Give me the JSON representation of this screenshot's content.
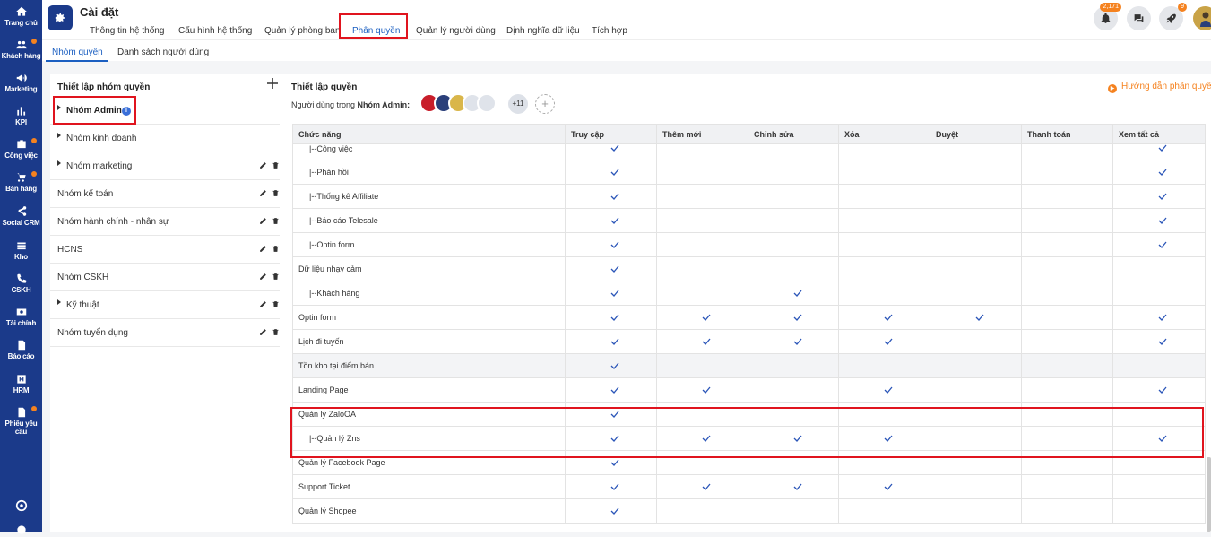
{
  "sidebar": {
    "items": [
      {
        "label": "Trang chủ",
        "icon": "home-icon",
        "dot": false
      },
      {
        "label": "Khách hàng",
        "icon": "customers-icon",
        "dot": true
      },
      {
        "label": "Marketing",
        "icon": "megaphone-icon",
        "dot": false
      },
      {
        "label": "KPI",
        "icon": "chart-icon",
        "dot": false
      },
      {
        "label": "Công việc",
        "icon": "briefcase-icon",
        "dot": true
      },
      {
        "label": "Bán hàng",
        "icon": "cart-icon",
        "dot": true
      },
      {
        "label": "Social CRM",
        "icon": "share-icon",
        "dot": false
      },
      {
        "label": "Kho",
        "icon": "warehouse-icon",
        "dot": false
      },
      {
        "label": "CSKH",
        "icon": "phone-icon",
        "dot": false
      },
      {
        "label": "Tài chính",
        "icon": "money-icon",
        "dot": false
      },
      {
        "label": "Báo cáo",
        "icon": "report-icon",
        "dot": false
      },
      {
        "label": "HRM",
        "icon": "hrm-icon",
        "dot": false
      },
      {
        "label": "Phiếu yêu cầu",
        "icon": "ticket-icon",
        "dot": true
      }
    ]
  },
  "header": {
    "title": "Cài đặt",
    "tabs": [
      "Thông tin hệ thống",
      "Cấu hình hệ thống",
      "Quản lý phòng ban",
      "Phân quyền",
      "Quản lý người dùng",
      "Định nghĩa dữ liệu",
      "Tích hợp"
    ],
    "active_tab": "Phân quyền",
    "notification_count": "2,171",
    "rocket_badge": "9"
  },
  "subtabs": [
    "Nhóm quyền",
    "Danh sách người dùng"
  ],
  "left_panel": {
    "title": "Thiết lập nhóm quyền",
    "groups": [
      {
        "name": "Nhóm Admin",
        "caret": true,
        "bold": true,
        "info": true,
        "actions": false
      },
      {
        "name": "Nhóm kinh doanh",
        "caret": true,
        "bold": false,
        "info": false,
        "actions": false
      },
      {
        "name": "Nhóm marketing",
        "caret": true,
        "bold": false,
        "info": false,
        "actions": true
      },
      {
        "name": "Nhóm kế toán",
        "caret": false,
        "bold": false,
        "info": false,
        "actions": true
      },
      {
        "name": "Nhóm hành chính - nhân sự",
        "caret": false,
        "bold": false,
        "info": false,
        "actions": true
      },
      {
        "name": "HCNS",
        "caret": false,
        "bold": false,
        "info": false,
        "actions": true
      },
      {
        "name": "Nhóm CSKH",
        "caret": false,
        "bold": false,
        "info": false,
        "actions": true
      },
      {
        "name": "Kỹ thuật",
        "caret": true,
        "bold": false,
        "info": false,
        "actions": true
      },
      {
        "name": "Nhóm tuyển dụng",
        "caret": false,
        "bold": false,
        "info": false,
        "actions": true
      }
    ]
  },
  "right_panel": {
    "title": "Thiết lập quyền",
    "users_label": "Người dùng trong",
    "group_name": "Nhóm Admin:",
    "more_users": "+11",
    "guide_link": "Hướng dẫn phân quyền",
    "columns": [
      "Chức năng",
      "Truy cập",
      "Thêm mới",
      "Chỉnh sửa",
      "Xóa",
      "Duyệt",
      "Thanh toán",
      "Xem tất cả"
    ],
    "rows": [
      {
        "name": "|--Công việc",
        "indent": true,
        "checks": [
          1,
          0,
          0,
          0,
          0,
          0,
          1
        ]
      },
      {
        "name": "|--Phản hồi",
        "indent": true,
        "checks": [
          1,
          0,
          0,
          0,
          0,
          0,
          1
        ]
      },
      {
        "name": "|--Thống kê Affiliate",
        "indent": true,
        "checks": [
          1,
          0,
          0,
          0,
          0,
          0,
          1
        ]
      },
      {
        "name": "|--Báo cáo Telesale",
        "indent": true,
        "checks": [
          1,
          0,
          0,
          0,
          0,
          0,
          1
        ]
      },
      {
        "name": "|--Optin form",
        "indent": true,
        "checks": [
          1,
          0,
          0,
          0,
          0,
          0,
          1
        ]
      },
      {
        "name": "Dữ liệu nhạy cảm",
        "indent": false,
        "checks": [
          1,
          0,
          0,
          0,
          0,
          0,
          0
        ]
      },
      {
        "name": "|--Khách hàng",
        "indent": true,
        "checks": [
          1,
          0,
          1,
          0,
          0,
          0,
          0
        ]
      },
      {
        "name": "Optin form",
        "indent": false,
        "checks": [
          1,
          1,
          1,
          1,
          1,
          0,
          1
        ]
      },
      {
        "name": "Lịch đi tuyến",
        "indent": false,
        "checks": [
          1,
          1,
          1,
          1,
          0,
          0,
          1
        ]
      },
      {
        "name": "Tồn kho tại điểm bán",
        "indent": false,
        "checks": [
          1,
          0,
          0,
          0,
          0,
          0,
          0
        ],
        "shade": true
      },
      {
        "name": "Landing Page",
        "indent": false,
        "checks": [
          1,
          1,
          0,
          1,
          0,
          0,
          1
        ]
      },
      {
        "name": "Quản lý ZaloOA",
        "indent": false,
        "checks": [
          1,
          0,
          0,
          0,
          0,
          0,
          0
        ]
      },
      {
        "name": "|--Quản lý Zns",
        "indent": true,
        "checks": [
          1,
          1,
          1,
          1,
          0,
          0,
          1
        ]
      },
      {
        "name": "Quản lý Facebook Page",
        "indent": false,
        "checks": [
          1,
          0,
          0,
          0,
          0,
          0,
          0
        ]
      },
      {
        "name": "Support Ticket",
        "indent": false,
        "checks": [
          1,
          1,
          1,
          1,
          0,
          0,
          0
        ]
      },
      {
        "name": "Quản lý Shopee",
        "indent": false,
        "checks": [
          1,
          0,
          0,
          0,
          0,
          0,
          0
        ]
      }
    ]
  },
  "colors": {
    "sidebar": "#1b3a8a",
    "accent": "#1b5fc1",
    "highlight": "#e0141e",
    "orange": "#f5821f"
  }
}
